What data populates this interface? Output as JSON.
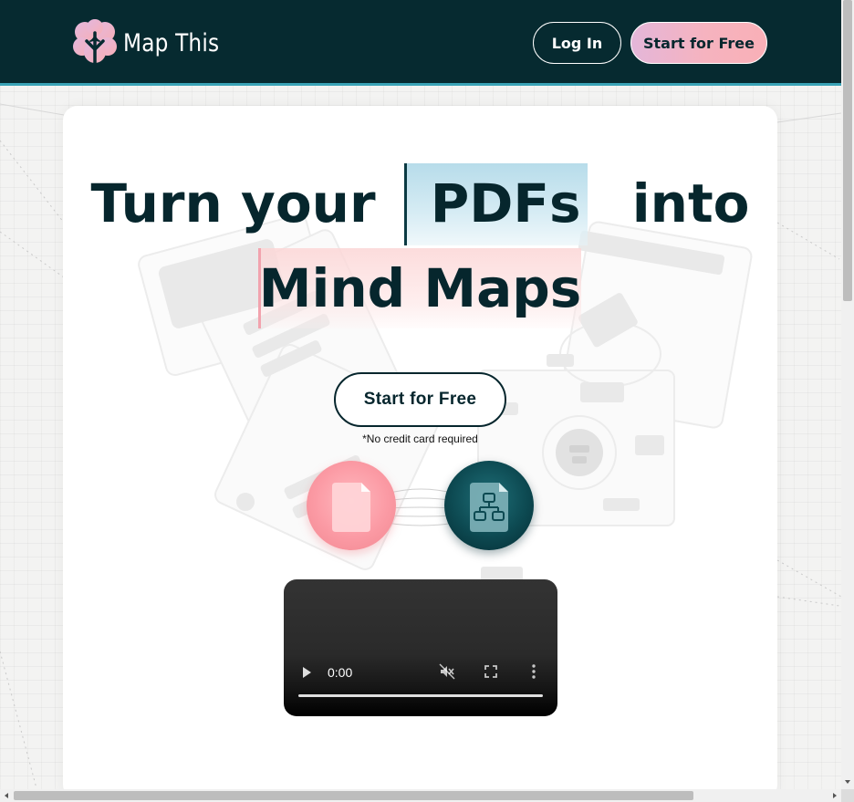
{
  "header": {
    "brand": "Map This",
    "login_label": "Log In",
    "start_label": "Start for Free",
    "logo_icon": "tree-flower-icon"
  },
  "hero": {
    "line1_before": "Turn your",
    "line1_highlight": "PDFs",
    "line1_after": "into",
    "line2_highlight": "Mind Maps",
    "cta_label": "Start for Free",
    "note": "*No credit card required",
    "pdf_orb_icon": "pdf-document-icon",
    "map_orb_icon": "mind-map-file-icon"
  },
  "video": {
    "time": "0:00",
    "play_icon": "play-icon",
    "mute_icon": "muted-speaker-icon",
    "fullscreen_icon": "fullscreen-icon",
    "more_icon": "more-options-icon"
  },
  "colors": {
    "header_bg": "#062a30",
    "accent_teal": "#3aa3b6",
    "highlight_blue": "#b7dcea",
    "highlight_pink": "#fcd6d6",
    "orb_pink": "#fb9aa4",
    "orb_teal": "#0d4a52",
    "text_dark": "#06262d"
  }
}
